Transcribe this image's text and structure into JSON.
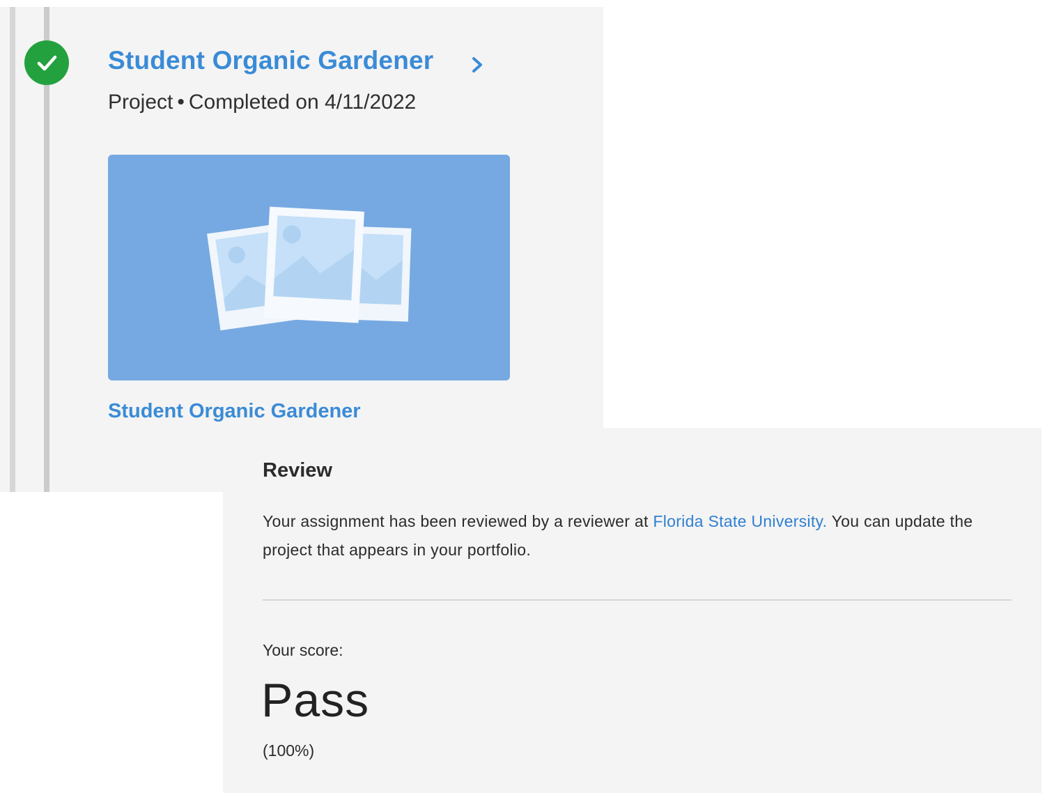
{
  "colors": {
    "accent_blue": "#3a8bd6",
    "link_blue": "#2f7fd1",
    "success_green": "#23a13f",
    "thumbnail_bg": "#76a9e1",
    "panel_bg": "#f4f4f4"
  },
  "project": {
    "status_icon": "check-icon",
    "title": "Student Organic Gardener",
    "type": "Project",
    "separator": "•",
    "completed": "Completed on 4/11/2022",
    "thumbnail_icon": "photos-placeholder-icon",
    "caption": "Student Organic Gardener"
  },
  "review": {
    "heading": "Review",
    "text_before": "Your assignment has been reviewed by a reviewer at ",
    "link_text": "Florida State University.",
    "text_after": " You can update the project that appears in your portfolio.",
    "score_label": "Your score:",
    "score_value": "Pass",
    "score_percent": "(100%)"
  }
}
